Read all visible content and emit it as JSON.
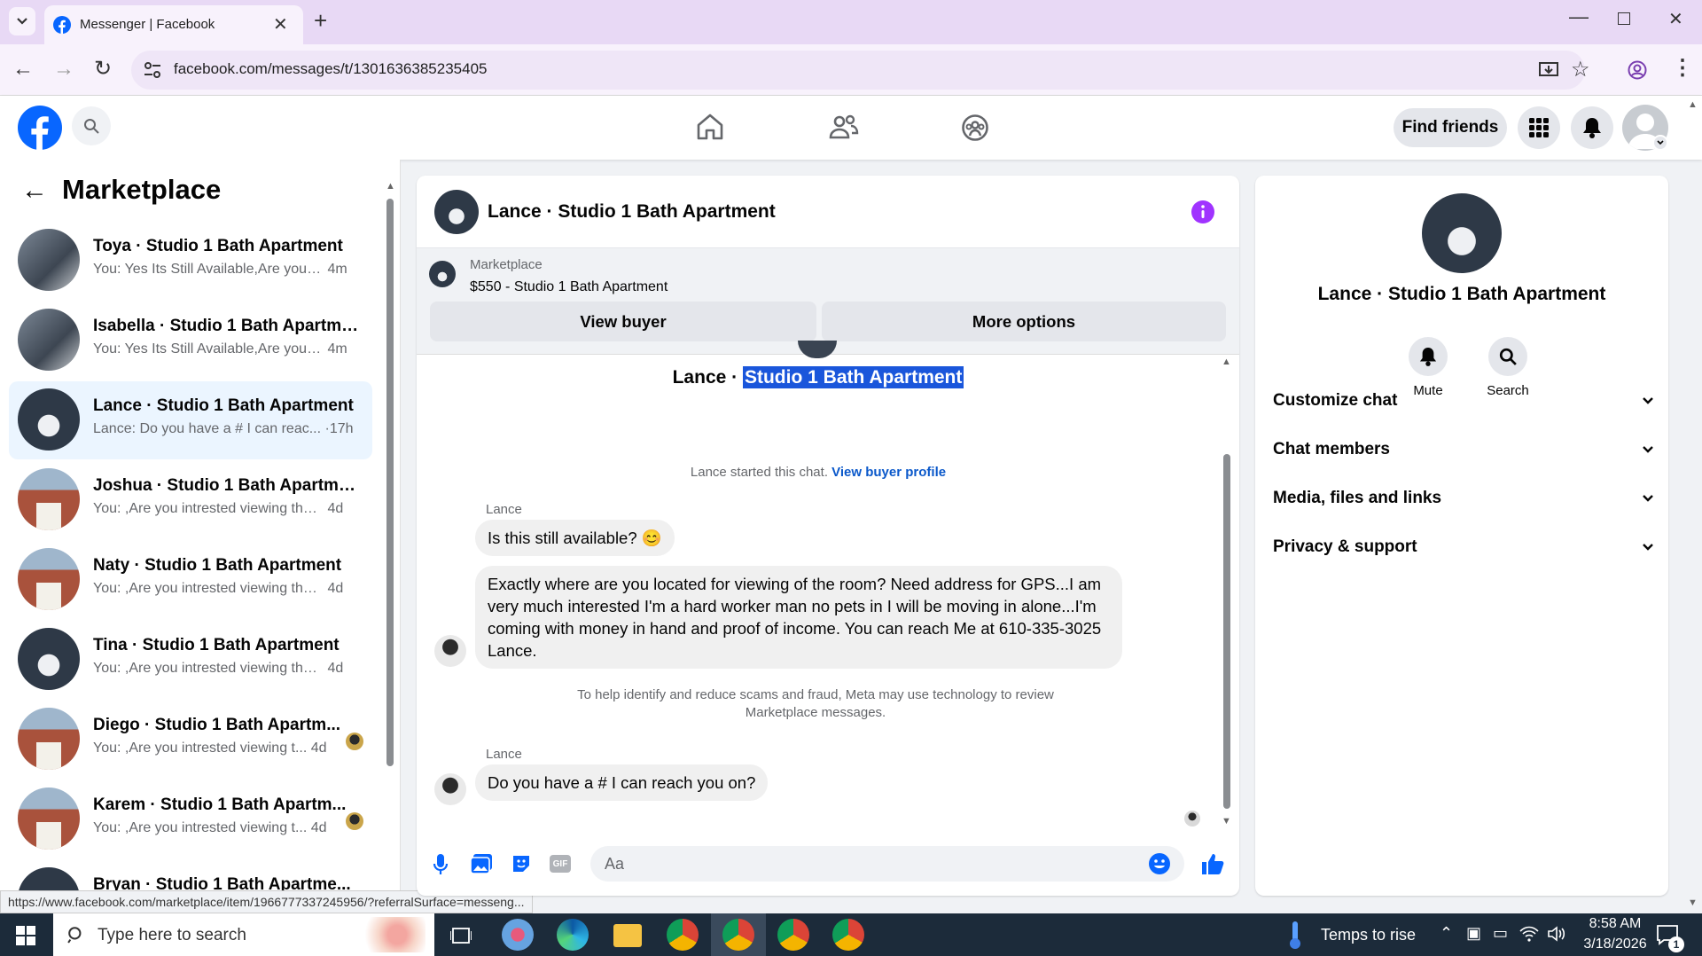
{
  "browser": {
    "tab_title": "Messenger | Facebook",
    "url": "facebook.com/messages/t/1301636385235405",
    "status_url": "https://www.facebook.com/marketplace/item/1966777337245956/?referralSurface=messeng..."
  },
  "header": {
    "find_friends": "Find friends"
  },
  "sidebar": {
    "title": "Marketplace",
    "conversations": [
      {
        "name": "Toya · Studio 1 Bath Apartment",
        "preview": "You: Yes Its Still Available,Are you i...",
        "time": "4m",
        "thumb": "kitchen"
      },
      {
        "name": "Isabella · Studio 1 Bath Apartment",
        "preview": "You: Yes Its Still Available,Are you i...",
        "time": "4m",
        "thumb": "kitchen"
      },
      {
        "name": "Lance · Studio 1 Bath Apartment",
        "preview": "Lance: Do you have a # I can reac...",
        "time": "·17h",
        "thumb": "bath"
      },
      {
        "name": "Joshua · Studio 1 Bath Apartment",
        "preview": "You: ,Are you intrested viewing the ...",
        "time": "4d",
        "thumb": "house"
      },
      {
        "name": "Naty · Studio 1 Bath Apartment",
        "preview": "You: ,Are you intrested viewing the ...",
        "time": "4d",
        "thumb": "house"
      },
      {
        "name": "Tina · Studio 1 Bath Apartment",
        "preview": "You: ,Are you intrested viewing the ...",
        "time": "4d",
        "thumb": "bath"
      },
      {
        "name": "Diego · Studio 1 Bath Apartm...",
        "preview": "You: ,Are you intrested viewing t...",
        "time": "4d",
        "thumb": "house"
      },
      {
        "name": "Karem · Studio 1 Bath Apartm...",
        "preview": "You: ,Are you intrested viewing t...",
        "time": "4d",
        "thumb": "house"
      },
      {
        "name": "Bryan · Studio 1 Bath Apartme...",
        "preview": "",
        "time": "",
        "thumb": "bath"
      }
    ]
  },
  "chat": {
    "title": "Lance · Studio 1 Bath Apartment",
    "listing_label": "Marketplace",
    "listing_price_title": "$550 - Studio 1 Bath Apartment",
    "view_buyer": "View buyer",
    "more_options": "More options",
    "thread_name_prefix": "Lance ·",
    "thread_name_highlight": "Studio 1 Bath Apartment",
    "started_text": "Lance started this chat.",
    "view_buyer_profile": "View buyer profile",
    "sender1": "Lance",
    "msg1": "Is this still available? 😊",
    "msg2": "Exactly where are you located for viewing of the room? Need address for GPS...I am very much interested I'm a hard worker man no pets in I will be moving in alone...I'm coming with money in hand and proof of income. You can reach Me at 610-335-3025 Lance.",
    "notice": "To help identify and reduce scams and fraud, Meta may use technology to review Marketplace messages.",
    "sender2": "Lance",
    "msg3": "Do you have a # I can reach you on?",
    "composer_placeholder": "Aa"
  },
  "right_panel": {
    "name": "Lance · Studio 1 Bath Apartment",
    "mute": "Mute",
    "search": "Search",
    "sections": [
      "Customize chat",
      "Chat members",
      "Media, files and links",
      "Privacy & support"
    ]
  },
  "taskbar": {
    "search_placeholder": "Type here to search",
    "weather": "Temps to rise",
    "time": "8:58 AM",
    "date": "3/18/2026",
    "notification_count": "1"
  },
  "colors": {
    "fb_blue": "#0866ff",
    "selection": "#1a56db",
    "messenger_accent": "#a033ff"
  }
}
